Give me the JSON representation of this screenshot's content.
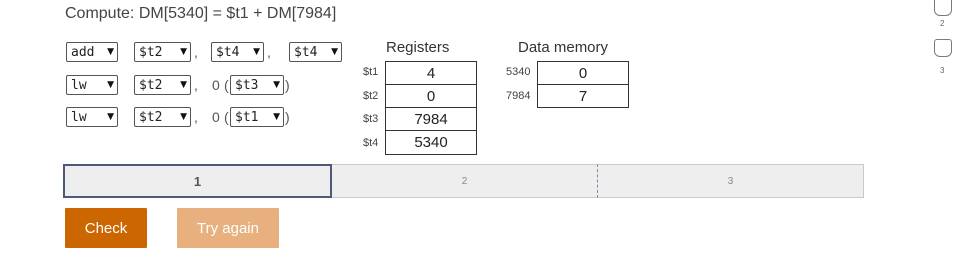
{
  "prompt": "Compute: DM[5340] = $t1 + DM[7984]",
  "instructions": [
    {
      "op": "add",
      "a": "$t2",
      "b": "$t4",
      "c": "$t4"
    },
    {
      "op": "lw",
      "a": "$t2",
      "offset": "0",
      "base": "$t3"
    },
    {
      "op": "lw",
      "a": "$t2",
      "offset": "0",
      "base": "$t1"
    }
  ],
  "punctuation": {
    "comma": ",",
    "open": "(",
    "close": ")"
  },
  "caret": "▼",
  "registers": {
    "title": "Registers",
    "rows": [
      {
        "name": "$t1",
        "value": "4"
      },
      {
        "name": "$t2",
        "value": "0"
      },
      {
        "name": "$t3",
        "value": "7984"
      },
      {
        "name": "$t4",
        "value": "5340"
      }
    ]
  },
  "memory": {
    "title": "Data memory",
    "rows": [
      {
        "addr": "5340",
        "value": "0"
      },
      {
        "addr": "7984",
        "value": "7"
      }
    ]
  },
  "progress": {
    "segments": [
      "1",
      "2",
      "3"
    ],
    "active": 0
  },
  "buttons": {
    "check": "Check",
    "try_again": "Try again"
  },
  "side_levels": [
    "2",
    "3"
  ]
}
